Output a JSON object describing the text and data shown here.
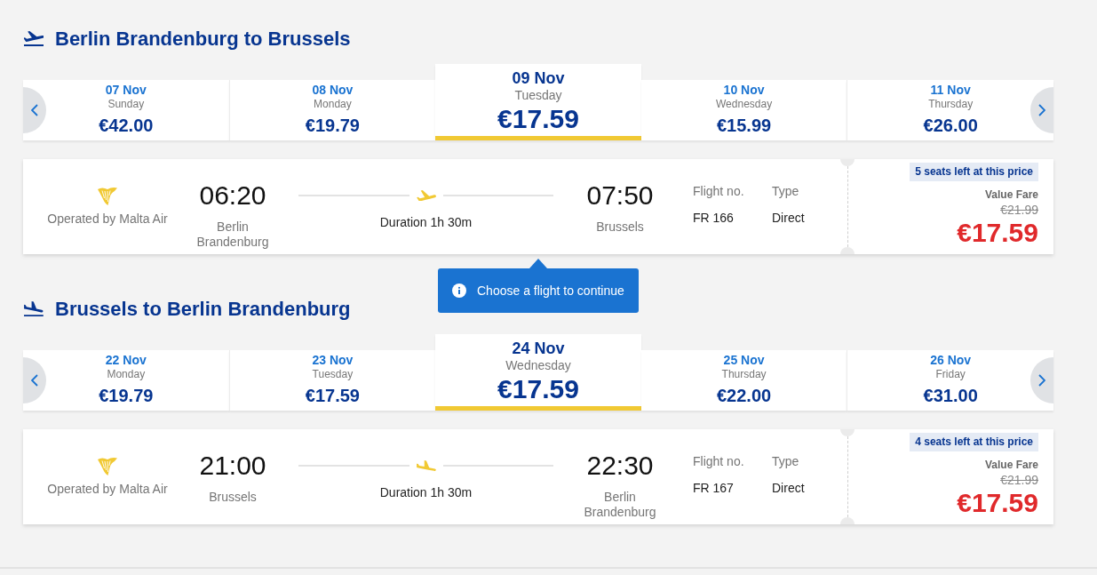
{
  "journeys": [
    {
      "kind": "outbound",
      "title": "Berlin Brandenburg to Brussels",
      "dates": [
        {
          "date": "07 Nov",
          "weekday": "Sunday",
          "price": "€42.00",
          "selected": false
        },
        {
          "date": "08 Nov",
          "weekday": "Monday",
          "price": "€19.79",
          "selected": false
        },
        {
          "date": "09 Nov",
          "weekday": "Tuesday",
          "price": "€17.59",
          "selected": true
        },
        {
          "date": "10 Nov",
          "weekday": "Wednesday",
          "price": "€15.99",
          "selected": false
        },
        {
          "date": "11 Nov",
          "weekday": "Thursday",
          "price": "€26.00",
          "selected": false
        }
      ],
      "flight": {
        "operator": "Operated by Malta Air",
        "departure_time": "06:20",
        "origin": "Berlin Brandenburg",
        "duration": "Duration 1h 30m",
        "arrival_time": "07:50",
        "destination": "Brussels",
        "flight_no_label": "Flight no.",
        "flight_no": "FR 166",
        "type_label": "Type",
        "type": "Direct",
        "seats_left": "5 seats left at this price",
        "fare": "Value Fare",
        "old_price": "€21.99",
        "price": "€17.59"
      },
      "tooltip": "Choose a flight to continue"
    },
    {
      "kind": "inbound",
      "title": "Brussels to Berlin Brandenburg",
      "dates": [
        {
          "date": "22 Nov",
          "weekday": "Monday",
          "price": "€19.79",
          "selected": false
        },
        {
          "date": "23 Nov",
          "weekday": "Tuesday",
          "price": "€17.59",
          "selected": false
        },
        {
          "date": "24 Nov",
          "weekday": "Wednesday",
          "price": "€17.59",
          "selected": true
        },
        {
          "date": "25 Nov",
          "weekday": "Thursday",
          "price": "€22.00",
          "selected": false
        },
        {
          "date": "26 Nov",
          "weekday": "Friday",
          "price": "€31.00",
          "selected": false
        }
      ],
      "flight": {
        "operator": "Operated by Malta Air",
        "departure_time": "21:00",
        "origin": "Brussels",
        "duration": "Duration 1h 30m",
        "arrival_time": "22:30",
        "destination": "Berlin Brandenburg",
        "flight_no_label": "Flight no.",
        "flight_no": "FR 167",
        "type_label": "Type",
        "type": "Direct",
        "seats_left": "4 seats left at this price",
        "fare": "Value Fare",
        "old_price": "€21.99",
        "price": "€17.59"
      }
    }
  ]
}
